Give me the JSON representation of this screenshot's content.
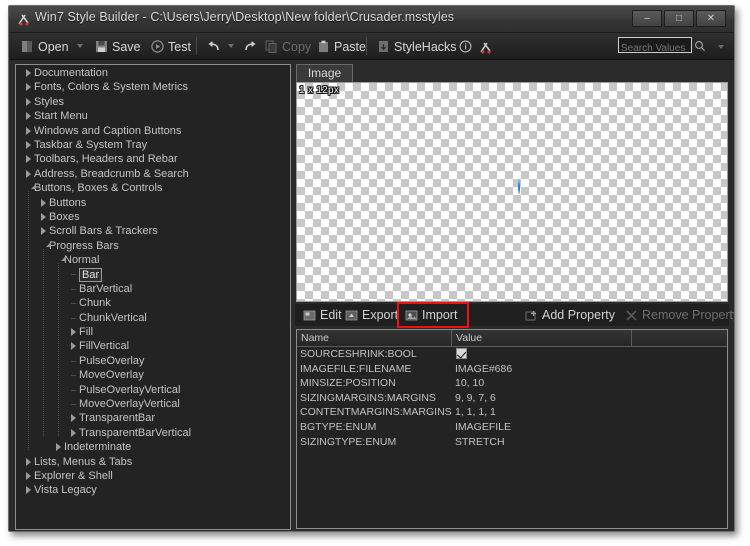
{
  "window": {
    "title": "Win7 Style Builder - C:\\Users\\Jerry\\Desktop\\New folder\\Crusader.msstyles",
    "minimize_label": "–",
    "maximize_label": "□",
    "close_label": "✕"
  },
  "toolbar": {
    "open_label": "Open",
    "save_label": "Save",
    "test_label": "Test",
    "copy_label": "Copy",
    "paste_label": "Paste",
    "stylehacks_label": "StyleHacks",
    "search_placeholder": "Search Values",
    "search_value": ""
  },
  "tree": {
    "items": [
      {
        "label": "Documentation",
        "depth": 0,
        "state": "collapsed"
      },
      {
        "label": "Fonts, Colors & System Metrics",
        "depth": 0,
        "state": "collapsed"
      },
      {
        "label": "Styles",
        "depth": 0,
        "state": "collapsed"
      },
      {
        "label": "Start Menu",
        "depth": 0,
        "state": "collapsed"
      },
      {
        "label": "Windows and Caption Buttons",
        "depth": 0,
        "state": "collapsed"
      },
      {
        "label": "Taskbar & System Tray",
        "depth": 0,
        "state": "collapsed"
      },
      {
        "label": "Toolbars, Headers and Rebar",
        "depth": 0,
        "state": "collapsed"
      },
      {
        "label": "Address, Breadcrumb & Search",
        "depth": 0,
        "state": "collapsed"
      },
      {
        "label": "Buttons, Boxes & Controls",
        "depth": 0,
        "state": "expanded"
      },
      {
        "label": "Buttons",
        "depth": 1,
        "state": "collapsed"
      },
      {
        "label": "Boxes",
        "depth": 1,
        "state": "collapsed"
      },
      {
        "label": "Scroll Bars & Trackers",
        "depth": 1,
        "state": "collapsed"
      },
      {
        "label": "Progress Bars",
        "depth": 1,
        "state": "expanded"
      },
      {
        "label": "Normal",
        "depth": 2,
        "state": "expanded"
      },
      {
        "label": "Bar",
        "depth": 3,
        "state": "leaf",
        "selected": true
      },
      {
        "label": "BarVertical",
        "depth": 3,
        "state": "leaf"
      },
      {
        "label": "Chunk",
        "depth": 3,
        "state": "leaf"
      },
      {
        "label": "ChunkVertical",
        "depth": 3,
        "state": "leaf"
      },
      {
        "label": "Fill",
        "depth": 3,
        "state": "collapsed"
      },
      {
        "label": "FillVertical",
        "depth": 3,
        "state": "collapsed"
      },
      {
        "label": "PulseOverlay",
        "depth": 3,
        "state": "leaf"
      },
      {
        "label": "MoveOverlay",
        "depth": 3,
        "state": "leaf"
      },
      {
        "label": "PulseOverlayVertical",
        "depth": 3,
        "state": "leaf"
      },
      {
        "label": "MoveOverlayVertical",
        "depth": 3,
        "state": "leaf"
      },
      {
        "label": "TransparentBar",
        "depth": 3,
        "state": "collapsed"
      },
      {
        "label": "TransparentBarVertical",
        "depth": 3,
        "state": "collapsed"
      },
      {
        "label": "Indeterminate",
        "depth": 2,
        "state": "collapsed"
      },
      {
        "label": "Lists, Menus & Tabs",
        "depth": 0,
        "state": "collapsed"
      },
      {
        "label": "Explorer & Shell",
        "depth": 0,
        "state": "collapsed"
      },
      {
        "label": "Vista Legacy",
        "depth": 0,
        "state": "collapsed"
      }
    ]
  },
  "preview": {
    "tab_label": "Image",
    "dimensions_label": "1 x 12px",
    "bitmap_color": "#2d82d6"
  },
  "actions": {
    "edit_label": "Edit",
    "export_label": "Export",
    "import_label": "Import",
    "add_property_label": "Add Property",
    "remove_property_label": "Remove Property",
    "highlight_color": "#ee1111",
    "highlighted_action": "Import"
  },
  "properties": {
    "columns": [
      "Name",
      "Value"
    ],
    "rows": [
      {
        "name": "SOURCESHRINK:BOOL",
        "value": "",
        "type": "checkbox",
        "checked": true
      },
      {
        "name": "IMAGEFILE:FILENAME",
        "value": "IMAGE#686",
        "type": "text"
      },
      {
        "name": "MINSIZE:POSITION",
        "value": "10, 10",
        "type": "text"
      },
      {
        "name": "SIZINGMARGINS:MARGINS",
        "value": "9, 9, 7, 6",
        "type": "text"
      },
      {
        "name": "CONTENTMARGINS:MARGINS",
        "value": "1, 1, 1, 1",
        "type": "text"
      },
      {
        "name": "BGTYPE:ENUM",
        "value": "IMAGEFILE",
        "type": "text"
      },
      {
        "name": "SIZINGTYPE:ENUM",
        "value": "STRETCH",
        "type": "text"
      }
    ]
  }
}
